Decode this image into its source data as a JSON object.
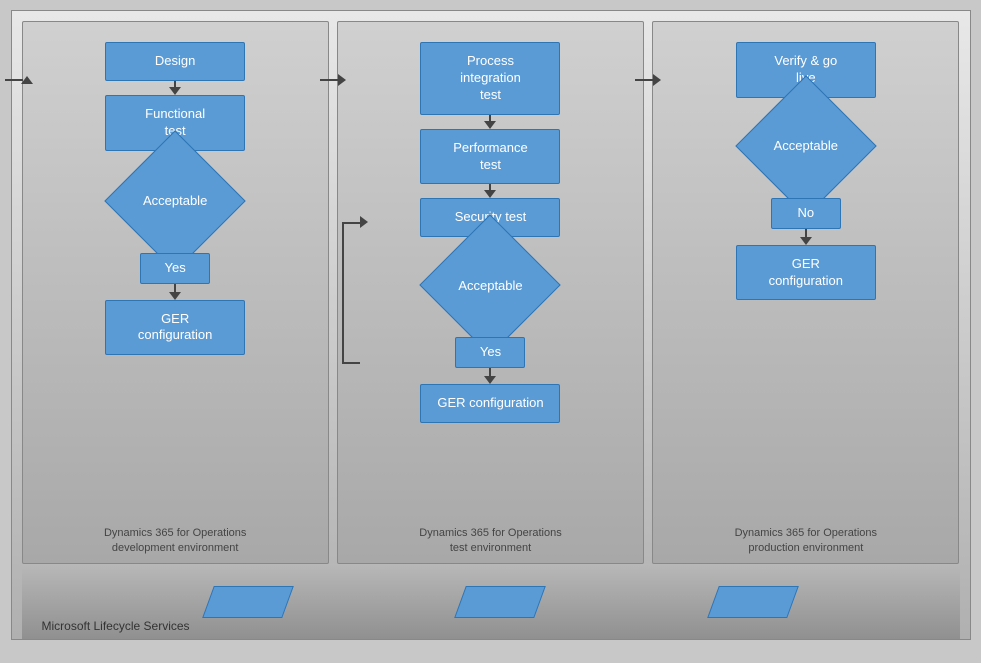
{
  "title": "Microsoft Lifecycle Services",
  "columns": [
    {
      "id": "dev",
      "label": "Dynamics 365 for Operations\ndevelopment environment",
      "nodes": [
        {
          "type": "entry"
        },
        {
          "type": "box",
          "text": "Design"
        },
        {
          "type": "arrow"
        },
        {
          "type": "box",
          "text": "Functional\ntest"
        },
        {
          "type": "arrow"
        },
        {
          "type": "diamond",
          "text": "Acceptable"
        },
        {
          "type": "yes-branch"
        },
        {
          "type": "box",
          "text": "GER\nconfiguration"
        }
      ]
    },
    {
      "id": "test",
      "label": "Dynamics 365 for Operations\ntest environment",
      "nodes": [
        {
          "type": "entry"
        },
        {
          "type": "box",
          "text": "Process\nintegration\ntest"
        },
        {
          "type": "arrow"
        },
        {
          "type": "box",
          "text": "Performance\ntest"
        },
        {
          "type": "arrow"
        },
        {
          "type": "box",
          "text": "Security test"
        },
        {
          "type": "arrow"
        },
        {
          "type": "diamond",
          "text": "Acceptable"
        },
        {
          "type": "yes-branch"
        },
        {
          "type": "box",
          "text": "GER configuration"
        }
      ]
    },
    {
      "id": "prod",
      "label": "Dynamics 365 for Operations\nproduction environment",
      "nodes": [
        {
          "type": "entry"
        },
        {
          "type": "box",
          "text": "Verify & go\nlive"
        },
        {
          "type": "arrow"
        },
        {
          "type": "diamond",
          "text": "Acceptable"
        },
        {
          "type": "no-branch"
        },
        {
          "type": "box",
          "text": "GER\nconfiguration"
        }
      ]
    }
  ],
  "bottom": {
    "label": "Microsoft Lifecycle Services",
    "parallelograms": 3
  },
  "labels": {
    "yes": "Yes",
    "no": "No"
  }
}
